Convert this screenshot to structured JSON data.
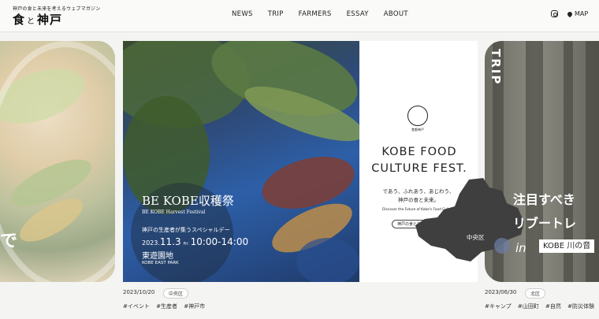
{
  "site": {
    "tagline": "神戸の食と未来を考えるウェブマガジン",
    "logo": "食と神戸",
    "logo_parts": {
      "a": "食",
      "b": "と",
      "c": "神戸"
    }
  },
  "nav": {
    "items": [
      "NEWS",
      "TRIP",
      "FARMERS",
      "ESSAY",
      "ABOUT"
    ],
    "map_label": "MAP"
  },
  "slide_left": {
    "overlay_text": "で"
  },
  "slide_main": {
    "title": "BE KOBE収穫祭",
    "subtitle": "BE KOBE Harvest Festival",
    "lead": "神戸の生産者が集うスペシャルデー",
    "date_prefix": "2023.",
    "date_month_day": "11.3",
    "date_weekday": "Fri",
    "time": "10:00-14:00",
    "venue": "東遊園地",
    "venue_en": "KOBE EAST PARK",
    "poster_badge": "食都神戸",
    "poster_title_1": "KOBE FOOD",
    "poster_title_2": "CULTURE FEST.",
    "poster_jp_1": "であう、ふれあう、あじわう、",
    "poster_jp_2": "神戸の食と未来。",
    "poster_en": "Discover the Future of Kobe's Food Culture",
    "poster_pill": "神戸の食と未来",
    "map_area_label": "中央区",
    "post_date": "2023/10/20",
    "area_badge": "中央区",
    "tags": [
      "#イベント",
      "#生産者",
      "#神戸市"
    ]
  },
  "slide_right": {
    "category": "TRIP",
    "title_line1": "注目すべき",
    "title_line2": "リブートレ",
    "title_in": "in",
    "title_place": "KOBE 川の音",
    "post_date": "2023/06/30",
    "area_badge": "北区",
    "tags": [
      "#キャンプ",
      "#山田町",
      "#自然",
      "#防災体験"
    ]
  },
  "colors": {
    "background": "#f4f4f2",
    "header_bg": "#fafaf8",
    "text": "#222222",
    "crate_blue": "#2d5fa8"
  },
  "icons": [
    "instagram-icon",
    "map-pin-icon"
  ]
}
